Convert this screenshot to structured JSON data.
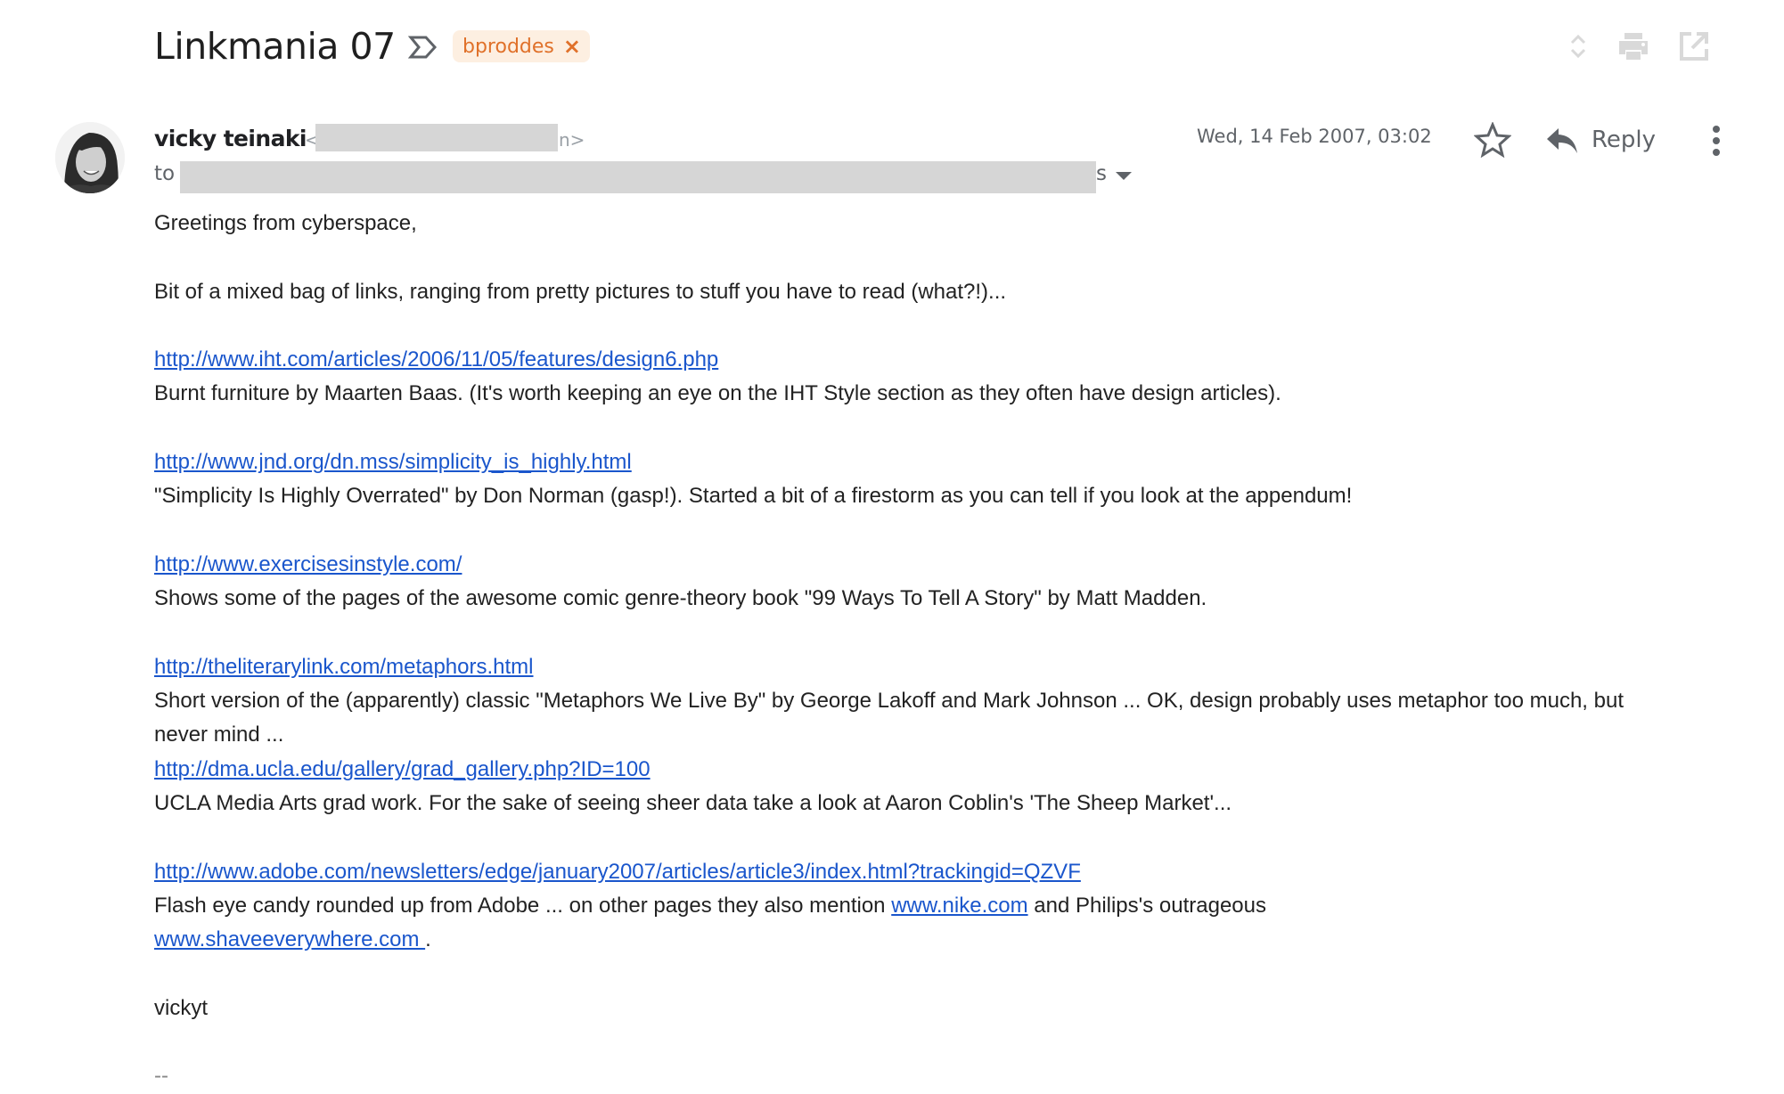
{
  "header": {
    "subject": "Linkmania 07",
    "important_marker": "important-icon",
    "label": {
      "name": "bproddes",
      "remove": "×",
      "color": "#e0712a",
      "background": "#fdefe1"
    },
    "actions": [
      {
        "icon": "expand-collapse-icon",
        "label": "Expand all"
      },
      {
        "icon": "print-icon",
        "label": "Print all"
      },
      {
        "icon": "open-in-new-window-icon",
        "label": "In new window"
      }
    ]
  },
  "message": {
    "sender_name": "vicky teinaki",
    "sender_email_open": "<",
    "sender_email_close": "n>",
    "to_label": "to",
    "to_tail": "s",
    "date": "Wed, 14 Feb 2007, 03:02",
    "reply_label": "Reply",
    "star_icon": "star-icon",
    "more_icon": "more-vertical-icon"
  },
  "body": {
    "greeting": "Greetings from cyberspace,",
    "intro": "Bit of a mixed bag of links, ranging from pretty pictures to stuff you have to read (what?!)...",
    "links": [
      {
        "url": "http://www.iht.com/articles/2006/11/05/features/design6.php",
        "desc": "Burnt furniture by Maarten Baas. (It's worth keeping an eye on the IHT Style section as they often have design articles)."
      },
      {
        "url": "http://www.jnd.org/dn.mss/simplicity_is_highly.html",
        "desc": "\"Simplicity Is Highly Overrated\" by Don Norman (gasp!). Started a bit of a firestorm as you can tell if you look at the appendum!"
      },
      {
        "url": "http://www.exercisesinstyle.com/",
        "desc": "Shows some of the pages of the awesome comic genre-theory book \"99 Ways To Tell A Story\" by Matt Madden."
      },
      {
        "url": "http://theliterarylink.com/metaphors.html",
        "desc": "Short version of the (apparently) classic \"Metaphors We Live By\" by George Lakoff and Mark Johnson ... OK, design probably uses metaphor too much, but never mind ..."
      },
      {
        "url": "http://dma.ucla.edu/gallery/grad_gallery.php?ID=100",
        "desc": "UCLA Media Arts grad work. For the sake of seeing sheer data take a look at Aaron Coblin's 'The Sheep Market'..."
      },
      {
        "url": "http://www.adobe.com/newsletters/edge/january2007/articles/article3/index.html?trackingid=QZVF ",
        "desc_before": "Flash eye candy rounded up from Adobe ... on other pages they also mention ",
        "inline_link_1": "www.nike.com",
        "desc_middle": " and Philips's outrageous",
        "inline_link_2": "www.shaveeverywhere.com ",
        "desc_after": "."
      }
    ],
    "signoff": "vickyt",
    "signature_separator": "--"
  },
  "colors": {
    "link": "#1a56cc",
    "text": "#222222",
    "secondary": "#5f6368",
    "redaction": "#d6d6d6"
  }
}
